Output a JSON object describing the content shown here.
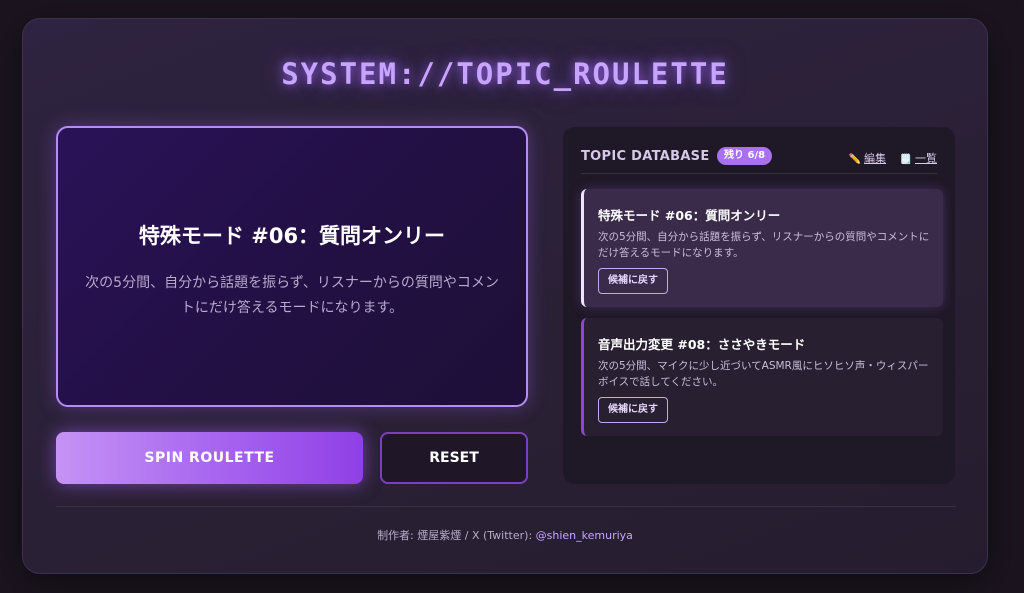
{
  "app": {
    "title": "SYSTEM://TOPIC_ROULETTE"
  },
  "result": {
    "title": "特殊モード #06：質問オンリー",
    "description": "次の5分間、自分から話題を振らず、リスナーからの質問やコメントにだけ答えるモードになります。"
  },
  "controls": {
    "spin_label": "SPIN ROULETTE",
    "reset_label": "RESET"
  },
  "database": {
    "title": "TOPIC DATABASE",
    "badge": "残り 6/8",
    "edit_label": "編集",
    "list_label": "一覧",
    "edit_icon": "pencil-icon",
    "list_icon": "memo-icon",
    "items": [
      {
        "title": "特殊モード #06：質問オンリー",
        "description": "次の5分間、自分から話題を振らず、リスナーからの質問やコメントにだけ答えるモードになります。",
        "button_label": "候補に戻す"
      },
      {
        "title": "音声出力変更 #08：ささやきモード",
        "description": "次の5分間、マイクに少し近づいてASMR風にヒソヒソ声・ウィスパーボイスで話してください。",
        "button_label": "候補に戻す"
      }
    ]
  },
  "footer": {
    "credit": "制作者: 煙屋紫煙 / X (Twitter): ",
    "handle": "@shien_kemuriya"
  },
  "colors": {
    "accent": "#a971f0",
    "glow": "#c7a4ff",
    "background": "#1c1520"
  }
}
